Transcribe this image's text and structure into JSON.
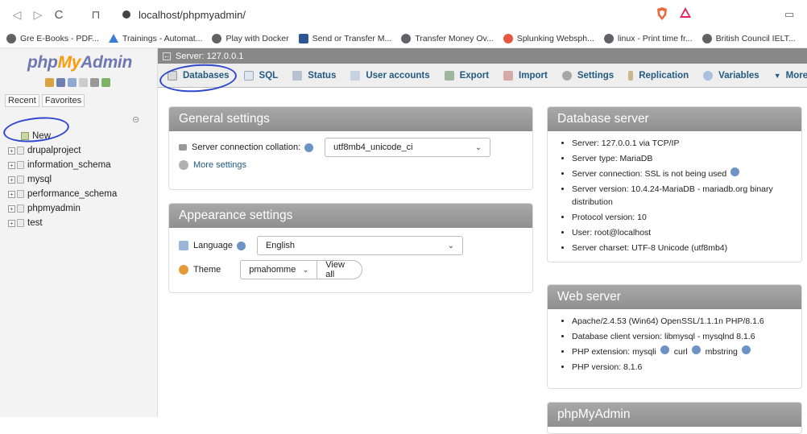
{
  "browser": {
    "url": "localhost/phpmyadmin/",
    "bookmarks": [
      {
        "label": "Gre E-Books - PDF...",
        "icon": "globe-icon"
      },
      {
        "label": "Trainings - Automat...",
        "icon": "triangle-icon"
      },
      {
        "label": "Play with Docker",
        "icon": "globe-icon"
      },
      {
        "label": "Send or Transfer M...",
        "icon": "square-icon"
      },
      {
        "label": "Transfer Money Ov...",
        "icon": "globe-icon"
      },
      {
        "label": "Splunking Websph...",
        "icon": "orange-icon"
      },
      {
        "label": "linux - Print time fr...",
        "icon": "globe-icon"
      },
      {
        "label": "British Council IELT...",
        "icon": "globe-icon"
      }
    ]
  },
  "sidebar": {
    "logo_php": "php",
    "logo_my": "My",
    "logo_admin": "Admin",
    "tab_recent": "Recent",
    "tab_favorites": "Favorites",
    "tree": [
      {
        "label": "New"
      },
      {
        "label": "drupalproject"
      },
      {
        "label": "information_schema"
      },
      {
        "label": "mysql"
      },
      {
        "label": "performance_schema"
      },
      {
        "label": "phpmyadmin"
      },
      {
        "label": "test"
      }
    ]
  },
  "topbar": {
    "server": "Server: 127.0.0.1",
    "menu": [
      {
        "label": "Databases"
      },
      {
        "label": "SQL"
      },
      {
        "label": "Status"
      },
      {
        "label": "User accounts"
      },
      {
        "label": "Export"
      },
      {
        "label": "Import"
      },
      {
        "label": "Settings"
      },
      {
        "label": "Replication"
      },
      {
        "label": "Variables"
      },
      {
        "label": "More"
      }
    ]
  },
  "general": {
    "title": "General settings",
    "collation_label": "Server connection collation:",
    "collation_value": "utf8mb4_unicode_ci",
    "more_settings": "More settings"
  },
  "appearance": {
    "title": "Appearance settings",
    "language_label": "Language",
    "language_value": "English",
    "theme_label": "Theme",
    "theme_value": "pmahomme",
    "view_all": "View all"
  },
  "db_server": {
    "title": "Database server",
    "items": [
      "Server: 127.0.0.1 via TCP/IP",
      "Server type: MariaDB",
      "Server connection: SSL is not being used",
      "Server version: 10.4.24-MariaDB - mariadb.org binary distribution",
      "Protocol version: 10",
      "User: root@localhost",
      "Server charset: UTF-8 Unicode (utf8mb4)"
    ]
  },
  "web_server": {
    "title": "Web server",
    "item0": "Apache/2.4.53 (Win64) OpenSSL/1.1.1n PHP/8.1.6",
    "item1": "Database client version: libmysql - mysqlnd 8.1.6",
    "item2_prefix": "PHP extension: mysqli",
    "item2_curl": "curl",
    "item2_mbstring": "mbstring",
    "item3": "PHP version: 8.1.6"
  },
  "pma_panel": {
    "title": "phpMyAdmin"
  }
}
